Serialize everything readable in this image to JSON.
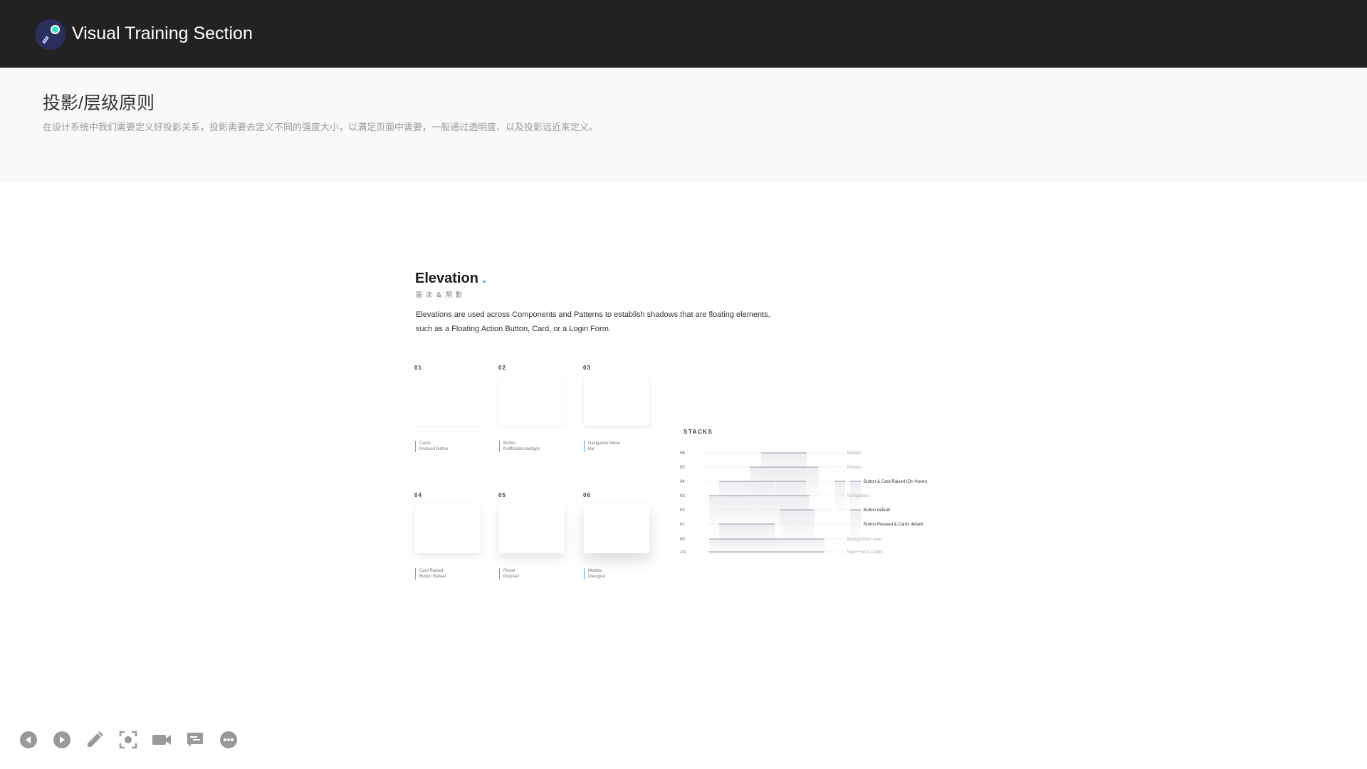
{
  "header": {
    "title": "Visual Training Section",
    "logo_icon": "magnifier-logo-icon"
  },
  "intro": {
    "title": "投影/层级原则",
    "description": "在设计系统中我们需要定义好投影关系，投影需要去定义不同的强度大小，以满足页面中需要，一般通过透明度、以及投影远近来定义。"
  },
  "slide": {
    "title": "Elevation",
    "title_accent": ".",
    "subtitle": "层次＆阴影",
    "description": "Elevations are used across Components and Patterns to establish shadows that are floating elements, such as a Floating Action Button, Card, or a Login Form.",
    "accent_color": "#2a9df4",
    "cards": [
      {
        "num": "01",
        "line1": "Cards",
        "line2": "Pressed button"
      },
      {
        "num": "02",
        "line1": "Button",
        "line2": "Notification badges"
      },
      {
        "num": "03",
        "line1": "Navigation Menu",
        "line2": "Bar"
      },
      {
        "num": "04",
        "line1": "Card Raised",
        "line2": "Button Raised"
      },
      {
        "num": "05",
        "line1": "Picker",
        "line2": "Popover"
      },
      {
        "num": "06",
        "line1": "Modals",
        "line2": "Dialogue"
      }
    ],
    "stacks": {
      "title": "STACKS",
      "levels": [
        {
          "level": "06",
          "label": "Modals",
          "emphasis": false
        },
        {
          "level": "05",
          "label": "Pickers",
          "emphasis": false
        },
        {
          "level": "04",
          "label": "Button & Card Raised (On Hover)",
          "emphasis": true
        },
        {
          "level": "03",
          "label": "Navigations",
          "emphasis": false
        },
        {
          "level": "02",
          "label": "Button default",
          "emphasis": true
        },
        {
          "level": "01",
          "label": "Button Pressed & Cards default",
          "emphasis": true
        },
        {
          "level": "00",
          "label": "Background Level",
          "emphasis": false
        },
        {
          "level": "-01",
          "label": "Input Forms Depth",
          "emphasis": false
        }
      ]
    }
  },
  "toolbar": {
    "buttons": [
      "previous-icon",
      "next-icon",
      "pen-icon",
      "screenshot-icon",
      "camera-icon",
      "comment-icon",
      "more-icon"
    ]
  }
}
